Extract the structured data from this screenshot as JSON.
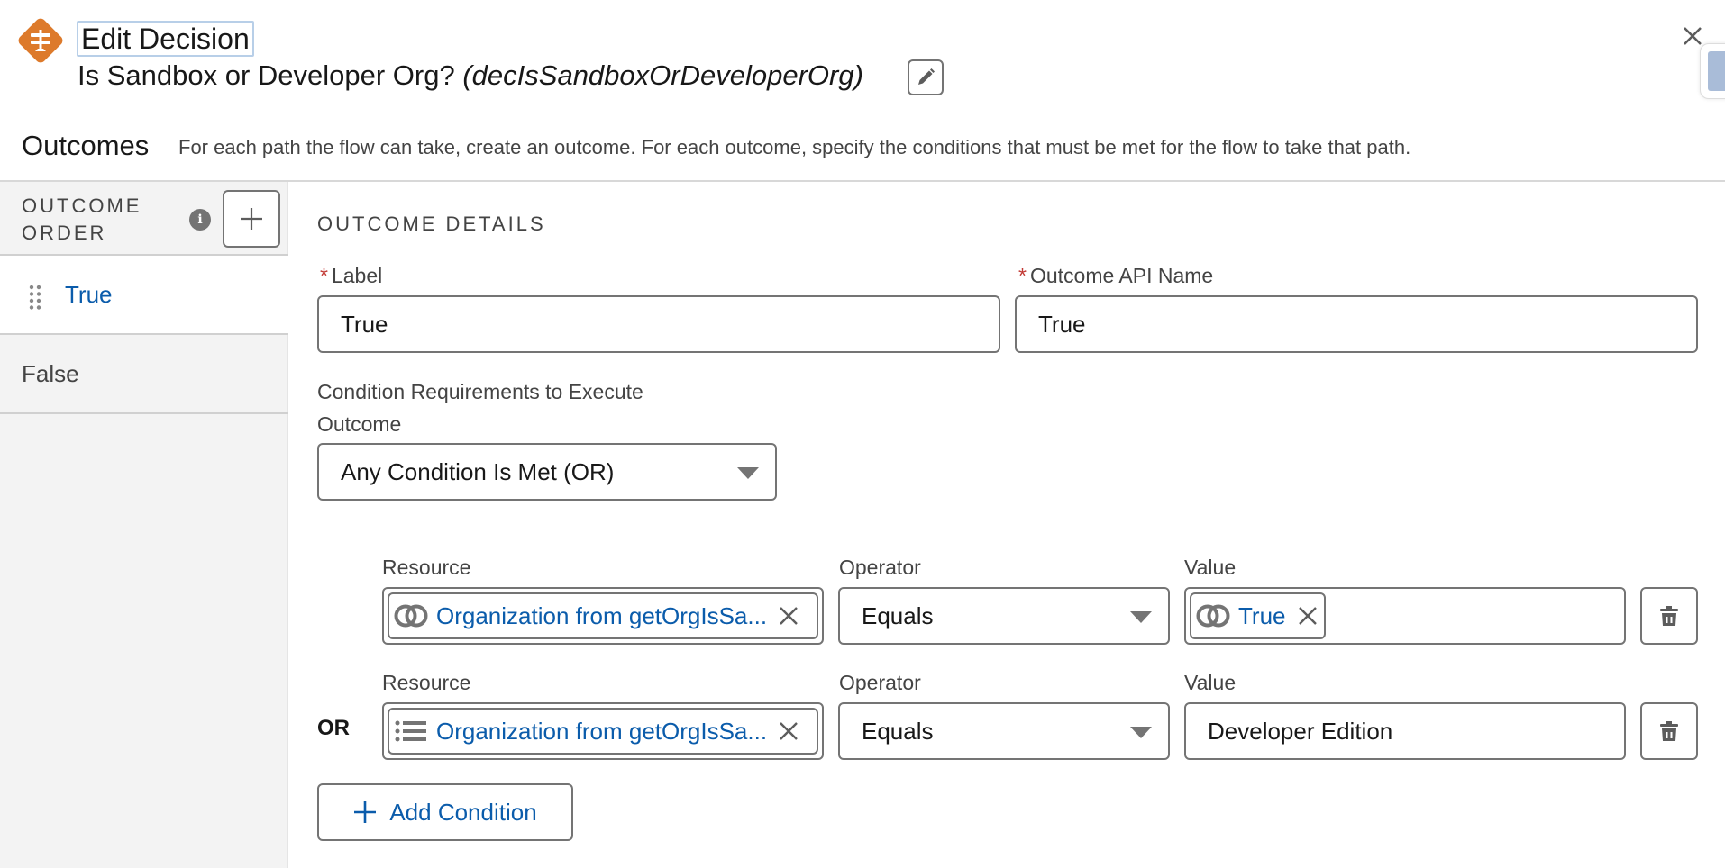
{
  "header": {
    "title": "Edit Decision",
    "element_label": "Is Sandbox or Developer Org?",
    "element_api_name": "(decIsSandboxOrDeveloperOrg)",
    "icons": {
      "element": "decision-icon",
      "edit": "pencil-icon",
      "close": "close-icon"
    },
    "brand_color": "#dd7a2b"
  },
  "outcomes_bar": {
    "title": "Outcomes",
    "description": "For each path the flow can take, create an outcome. For each outcome, specify the conditions that must be met for the flow to take that path."
  },
  "outcome_order": {
    "title_line1": "OUTCOME",
    "title_line2": "ORDER",
    "info_icon": "i",
    "add_icon": "plus-icon",
    "items": [
      {
        "label": "True",
        "selected": true
      },
      {
        "label": "False",
        "selected": false
      }
    ]
  },
  "outcome_details": {
    "section_title": "OUTCOME DETAILS",
    "label_field": {
      "label": "Label",
      "required": true,
      "value": "True"
    },
    "api_name_field": {
      "label": "Outcome API Name",
      "required": true,
      "value": "True"
    },
    "condition_requirements": {
      "label_line1": "Condition Requirements to Execute",
      "label_line2": "Outcome",
      "selected": "Any Condition Is Met (OR)"
    },
    "conditions": [
      {
        "prefix": "",
        "resource_label": "Resource",
        "resource_value": "Organization from getOrgIsSa...",
        "resource_icon": "boolean-rings-icon",
        "operator_label": "Operator",
        "operator_value": "Equals",
        "value_label": "Value",
        "value_pill": "True",
        "value_icon": "boolean-rings-icon"
      },
      {
        "prefix": "OR",
        "resource_label": "Resource",
        "resource_value": "Organization from getOrgIsSa...",
        "resource_icon": "picklist-icon",
        "operator_label": "Operator",
        "operator_value": "Equals",
        "value_label": "Value",
        "value_text": "Developer Edition"
      }
    ],
    "add_condition_label": "Add Condition"
  },
  "colors": {
    "link_blue": "#0b5cab",
    "required_red": "#c23934",
    "border_gray": "#747474",
    "panel_bg": "#f3f3f3"
  }
}
